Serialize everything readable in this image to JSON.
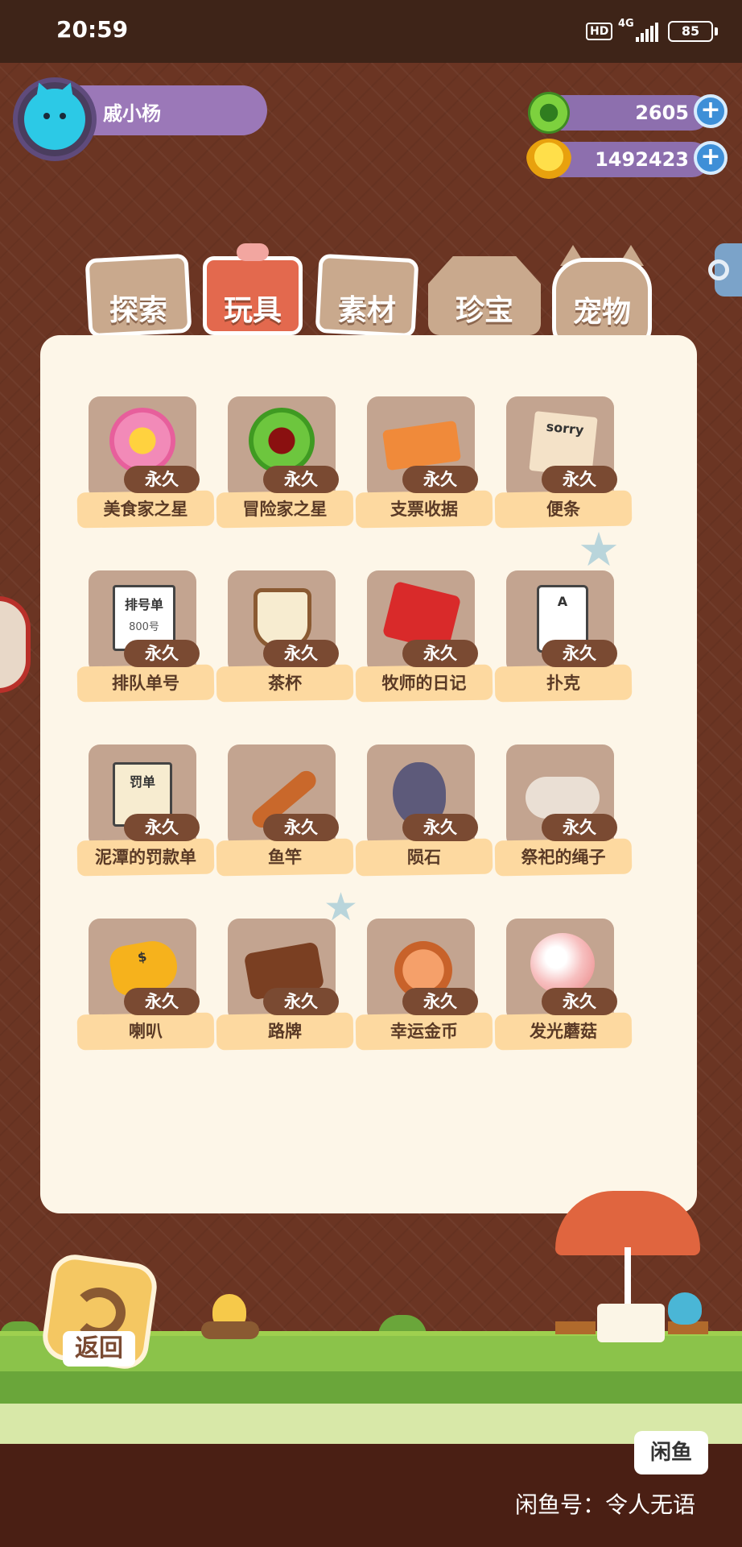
{
  "status_bar": {
    "time": "20:59",
    "hd": "HD",
    "network": "4G",
    "battery": "85"
  },
  "user": {
    "name": "戚小杨"
  },
  "currency": {
    "gems": "2605",
    "coins": "1492423"
  },
  "tabs": [
    {
      "label": "探索"
    },
    {
      "label": "玩具"
    },
    {
      "label": "素材"
    },
    {
      "label": "珍宝"
    },
    {
      "label": "宠物"
    }
  ],
  "active_tab": "素材",
  "items": [
    {
      "name": "美食家之星",
      "duration": "永久",
      "icon": "pink-flower-star-icon"
    },
    {
      "name": "冒险家之星",
      "duration": "永久",
      "icon": "green-flower-star-icon"
    },
    {
      "name": "支票收据",
      "duration": "永久",
      "icon": "check-receipt-icon"
    },
    {
      "name": "便条",
      "duration": "永久",
      "icon": "sorry-note-icon",
      "art_text": "sorry"
    },
    {
      "name": "排队单号",
      "duration": "永久",
      "icon": "queue-ticket-icon",
      "art_text": "排号单",
      "art_text_2": "800号"
    },
    {
      "name": "茶杯",
      "duration": "永久",
      "icon": "tea-cup-icon"
    },
    {
      "name": "牧师的日记",
      "duration": "永久",
      "icon": "red-diary-icon"
    },
    {
      "name": "扑克",
      "duration": "永久",
      "icon": "playing-card-icon",
      "art_text": "A"
    },
    {
      "name": "泥潭的罚款单",
      "duration": "永久",
      "icon": "fine-ticket-icon",
      "art_text": "罚单"
    },
    {
      "name": "鱼竿",
      "duration": "永久",
      "icon": "fishing-rod-icon"
    },
    {
      "name": "陨石",
      "duration": "永久",
      "icon": "meteorite-icon"
    },
    {
      "name": "祭祀的绳子",
      "duration": "永久",
      "icon": "ritual-rope-icon"
    },
    {
      "name": "喇叭",
      "duration": "永久",
      "icon": "megaphone-icon",
      "art_text": "$"
    },
    {
      "name": "路牌",
      "duration": "永久",
      "icon": "signpost-icon"
    },
    {
      "name": "幸运金币",
      "duration": "永久",
      "icon": "lucky-coin-icon"
    },
    {
      "name": "发光蘑菇",
      "duration": "永久",
      "icon": "glowing-mushroom-icon"
    }
  ],
  "return_button": {
    "label": "返回"
  },
  "watermark": {
    "logo": "闲鱼",
    "text": "闲鱼号：令人无语"
  },
  "colors": {
    "background": "#6b3523",
    "panel": "#fdf6e8",
    "active_tab": "#e3694e",
    "inactive_tab": "#c9a98d",
    "badge": "#7a4a32",
    "item_label_bg": "#fdd9a0",
    "currency_pill": "#8d6fae"
  }
}
